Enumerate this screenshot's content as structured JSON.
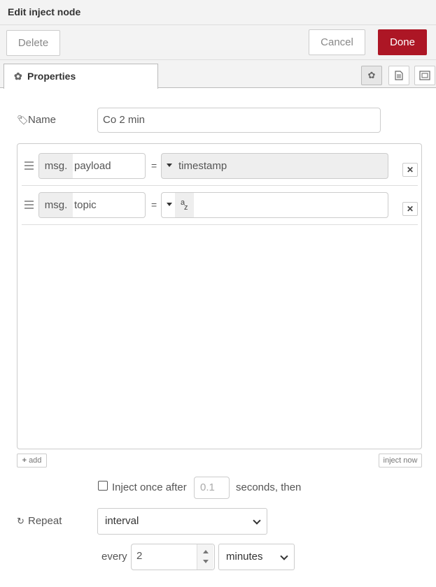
{
  "window": {
    "title": "Edit inject node"
  },
  "toolbar": {
    "delete_label": "Delete",
    "cancel_label": "Cancel",
    "done_label": "Done",
    "done_color": "#ad1625"
  },
  "tabs": {
    "properties_label": "Properties",
    "icons": [
      "gear-icon",
      "description-icon",
      "appearance-icon"
    ]
  },
  "form": {
    "name_label": "Name",
    "name_value": "Co 2 min",
    "props": [
      {
        "prefix": "msg.",
        "key": "payload",
        "type_icon": "caret-down-icon",
        "value": "timestamp"
      },
      {
        "prefix": "msg.",
        "key": "topic",
        "type_icon": "string-type-icon",
        "type_glyph_a": "a",
        "type_glyph_z": "z",
        "value": ""
      }
    ],
    "equals": "=",
    "add_label": "add",
    "inject_now_label": "inject now",
    "inject_once_label": "Inject once after",
    "inject_once_checked": false,
    "inject_delay_placeholder": "0.1",
    "seconds_then_label": "seconds, then",
    "repeat_label": "Repeat",
    "repeat_value": "interval",
    "every_label": "every",
    "every_value": "2",
    "unit_value": "minutes"
  }
}
